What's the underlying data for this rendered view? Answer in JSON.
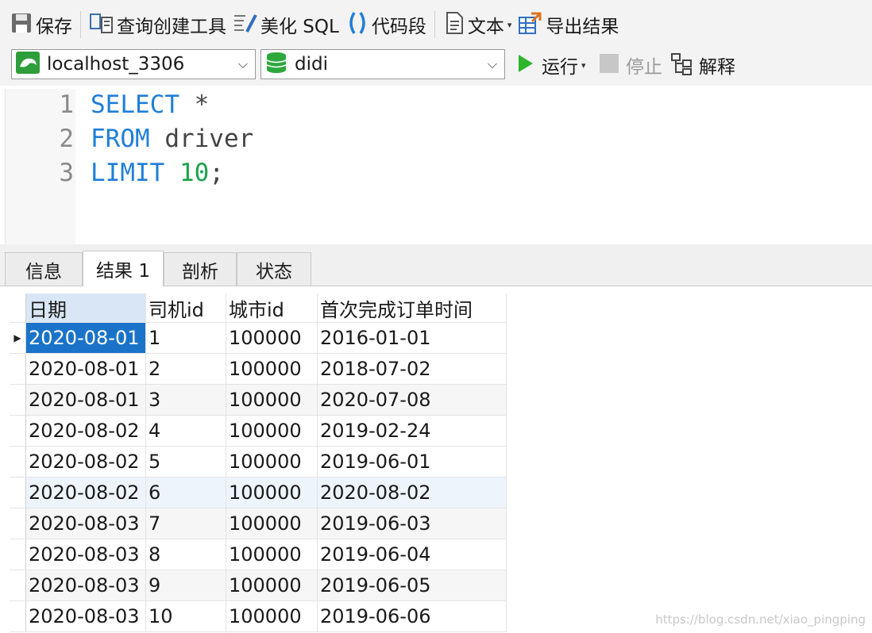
{
  "toolbar": {
    "save": "保存",
    "query_builder": "查询创建工具",
    "beautify_sql": "美化 SQL",
    "code_snippet": "代码段",
    "text": "文本",
    "export_result": "导出结果"
  },
  "connection": {
    "server": "localhost_3306",
    "database": "didi",
    "run": "运行",
    "stop": "停止",
    "explain": "解释"
  },
  "editor": {
    "lines": [
      {
        "num": "1",
        "kw": "SELECT",
        "rest": " *",
        "num_lit": ""
      },
      {
        "num": "2",
        "kw": "FROM",
        "rest": " driver",
        "num_lit": ""
      },
      {
        "num": "3",
        "kw": "LIMIT",
        "rest": " ",
        "num_lit": "10",
        "tail": ";"
      }
    ]
  },
  "tabs": [
    "信息",
    "结果 1",
    "剖析",
    "状态"
  ],
  "result": {
    "columns": [
      "日期",
      "司机id",
      "城市id",
      "首次完成订单时间"
    ],
    "rows": [
      [
        "2020-08-01",
        "1",
        "100000",
        "2016-01-01"
      ],
      [
        "2020-08-01",
        "2",
        "100000",
        "2018-07-02"
      ],
      [
        "2020-08-01",
        "3",
        "100000",
        "2020-07-08"
      ],
      [
        "2020-08-02",
        "4",
        "100000",
        "2019-02-24"
      ],
      [
        "2020-08-02",
        "5",
        "100000",
        "2019-06-01"
      ],
      [
        "2020-08-02",
        "6",
        "100000",
        "2020-08-02"
      ],
      [
        "2020-08-03",
        "7",
        "100000",
        "2019-06-03"
      ],
      [
        "2020-08-03",
        "8",
        "100000",
        "2019-06-04"
      ],
      [
        "2020-08-03",
        "9",
        "100000",
        "2019-06-05"
      ],
      [
        "2020-08-03",
        "10",
        "100000",
        "2019-06-06"
      ]
    ]
  },
  "watermark": "https://blog.csdn.net/xiao_pingping",
  "colors": {
    "keyword": "#1f7fd9",
    "number": "#1aa34a",
    "selection": "#1a73c9",
    "run_green": "#2db52d"
  }
}
